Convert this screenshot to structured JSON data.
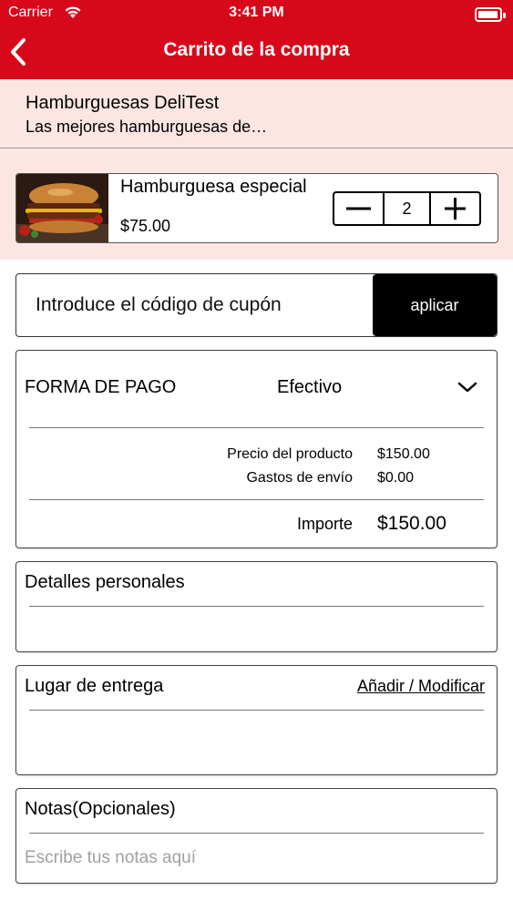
{
  "status_bar": {
    "carrier": "Carrier",
    "time": "3:41 PM"
  },
  "nav": {
    "title": "Carrito de la compra"
  },
  "store": {
    "name": "Hamburguesas DeliTest",
    "description": "Las mejores hamburguesas de…"
  },
  "cart_items": [
    {
      "name": "Hamburguesa especial",
      "price": "$75.00",
      "quantity": "2"
    }
  ],
  "coupon": {
    "placeholder": "Introduce el código de cupón",
    "apply_label": "aplicar"
  },
  "payment": {
    "label": "FORMA DE PAGO",
    "method": "Efectivo",
    "product_price_label": "Precio del producto",
    "product_price": "$150.00",
    "shipping_label": "Gastos de envío",
    "shipping": "$0.00",
    "total_label": "Importe",
    "total": "$150.00"
  },
  "personal_details": {
    "title": "Detalles personales"
  },
  "delivery": {
    "title": "Lugar de entrega",
    "action_label": "Añadir / Modificar"
  },
  "notes": {
    "title": "Notas(Opcionales)",
    "placeholder": "Escribe tus notas aquí"
  },
  "colors": {
    "header_red": "#d7081a",
    "store_bg": "#fce6e4",
    "apply_button": "#000000"
  }
}
